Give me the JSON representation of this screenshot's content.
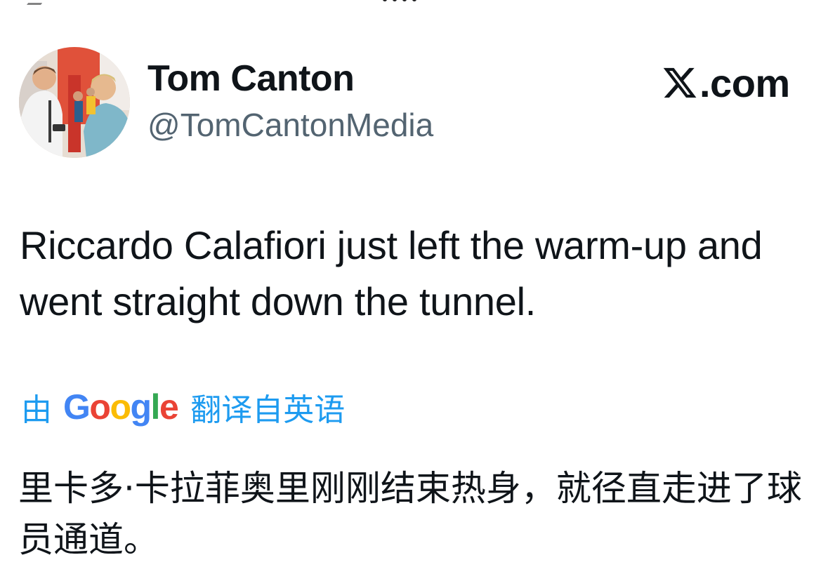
{
  "author": {
    "display_name": "Tom Canton",
    "handle": "@TomCantonMedia"
  },
  "brand": {
    "logo_icon": "x-logo-icon",
    "domain_suffix": ".com"
  },
  "tweet": {
    "text": "Riccardo Calafiori just left the warm-up and went straight down the tunnel."
  },
  "translation": {
    "prefix": "由",
    "provider_letters": [
      "G",
      "o",
      "o",
      "g",
      "l",
      "e"
    ],
    "suffix": "翻译自英语",
    "text": "里卡多·卡拉菲奥里刚刚结束热身，就径直走进了球员通道。"
  },
  "colors": {
    "name": "#0f1419",
    "handle": "#536471",
    "translate_link": "#1d9bf0",
    "google_blue": "#4285f4",
    "google_red": "#ea4335",
    "google_yellow": "#fbbc05",
    "google_green": "#34a853"
  }
}
